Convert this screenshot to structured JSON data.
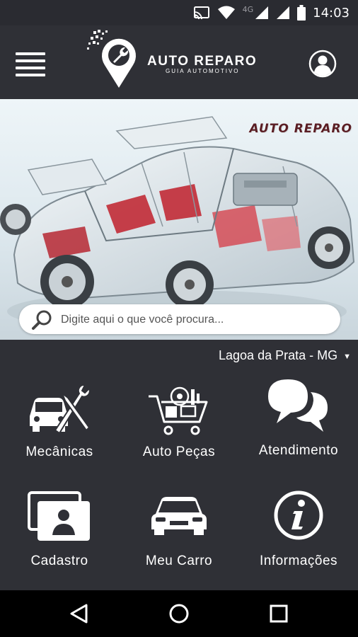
{
  "status_bar": {
    "network": "4G",
    "time": "14:03",
    "icons": [
      "cast-icon",
      "wifi-icon",
      "signal-icon",
      "signal-icon",
      "battery-icon"
    ]
  },
  "header": {
    "menu_icon": "hamburger-menu-icon",
    "logo_title": "AUTO REPARO",
    "logo_subtitle": "GUIA AUTOMOTIVO",
    "profile_icon": "user-profile-icon"
  },
  "banner": {
    "watermark": "AUTO REPARO"
  },
  "search": {
    "placeholder": "Digite aqui o que você procura..."
  },
  "location": {
    "label": "Lagoa da Prata - MG",
    "caret": "▼"
  },
  "grid": {
    "items": [
      {
        "label": "Mecânicas",
        "icon": "mechanic-car-tools-icon"
      },
      {
        "label": "Auto Peças",
        "icon": "auto-parts-cart-icon"
      },
      {
        "label": "Atendimento",
        "icon": "chat-bubbles-icon"
      },
      {
        "label": "Cadastro",
        "icon": "profile-card-icon"
      },
      {
        "label": "Meu Carro",
        "icon": "car-front-icon"
      },
      {
        "label": "Informações",
        "icon": "info-icon"
      }
    ]
  },
  "nav_bar": {
    "icons": [
      "back-icon",
      "home-icon",
      "recents-icon"
    ]
  },
  "colors": {
    "background": "#2f3036",
    "text": "#ffffff",
    "nav_bar": "#000000",
    "accent_red": "#c0202c"
  }
}
